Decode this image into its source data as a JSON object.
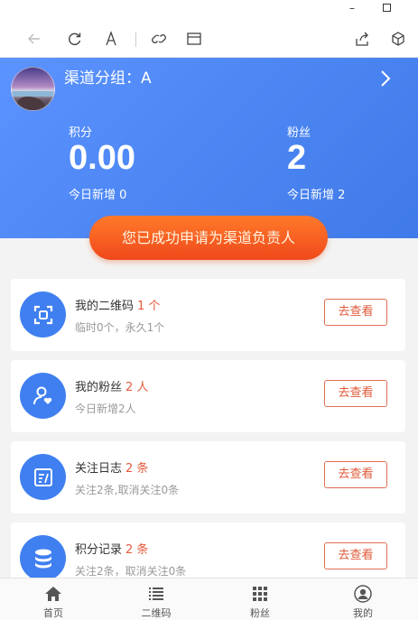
{
  "window": {
    "minimize": "–",
    "maximize": ""
  },
  "header": {
    "group_title": "渠道分组：A",
    "points_label": "积分",
    "points_value": "0.00",
    "points_today": "今日新增 0",
    "fans_label": "粉丝",
    "fans_value": "2",
    "fans_today": "今日新增 2"
  },
  "apply_button": "您已成功申请为渠道负责人",
  "cards": [
    {
      "title": "我的二维码",
      "count": "1 个",
      "sub": "临时0个，永久1个",
      "button": "去查看",
      "icon": "qr-scan-icon"
    },
    {
      "title": "我的粉丝",
      "count": "2 人",
      "sub": "今日新增2人",
      "button": "去查看",
      "icon": "user-heart-icon"
    },
    {
      "title": "关注日志",
      "count": "2 条",
      "sub": "关注2条,取消关注0条",
      "button": "去查看",
      "icon": "log-icon"
    },
    {
      "title": "积分记录",
      "count": "2 条",
      "sub": "关注2条，取消关注0条",
      "button": "去查看",
      "icon": "database-icon"
    }
  ],
  "nav": [
    {
      "label": "首页",
      "icon": "home-icon"
    },
    {
      "label": "二维码",
      "icon": "list-icon"
    },
    {
      "label": "粉丝",
      "icon": "grid-icon"
    },
    {
      "label": "我的",
      "icon": "user-circle-icon"
    }
  ],
  "colors": {
    "header_blue": "#4f88f5",
    "accent_orange": "#f0491b",
    "count_red": "#e55a3c",
    "icon_blue": "#3f7ff0"
  }
}
